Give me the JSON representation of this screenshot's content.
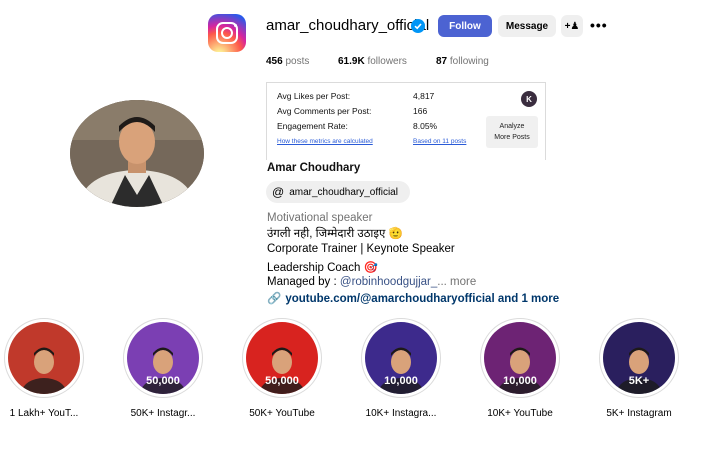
{
  "profile": {
    "username": "amar_choudhary_official",
    "follow_label": "Follow",
    "message_label": "Message",
    "suggest_icon": "add-person-icon",
    "more_icon": "more-dots-icon",
    "brand_color": "#4c63d2"
  },
  "stats": {
    "posts_count": "456",
    "posts_label": "posts",
    "followers_count": "61.9K",
    "followers_label": "followers",
    "following_count": "87",
    "following_label": "following"
  },
  "analytics": {
    "likes_label": "Avg Likes per Post:",
    "likes_value": "4,817",
    "comments_label": "Avg Comments per Post:",
    "comments_value": "166",
    "engagement_label": "Engagement Rate:",
    "engagement_value": "8.05%",
    "metrics_link": "How these metrics are calculated",
    "based_on_link": "Based on 11 posts",
    "analyze_line1": "Analyze",
    "analyze_line2": "More Posts",
    "badge_letter": "K"
  },
  "bio": {
    "full_name": "Amar Choudhary",
    "threads_handle": "amar_choudhary_official",
    "category": "Motivational speaker",
    "line1": "उंगली नही, जिम्मेदारी उठाइए 🫡",
    "line2": "Corporate Trainer | Keynote Speaker",
    "line3": "Leadership Coach 🎯",
    "managed_prefix": "Managed by : ",
    "managed_mention": "@robinhoodgujjar_",
    "ellipsis": "...",
    "more": " more",
    "link_text": "youtube.com/@amarchoudharyofficial and 1 more"
  },
  "highlights": [
    {
      "label": "1 Lakh+ YouT...",
      "badge": "",
      "color": "#c0392b"
    },
    {
      "label": "50K+ Instagr...",
      "badge": "50,000",
      "color": "#7b3fb3"
    },
    {
      "label": "50K+ YouTube",
      "badge": "50,000",
      "color": "#d8231f"
    },
    {
      "label": "10K+ Instagra...",
      "badge": "10,000",
      "color": "#3d2a8c"
    },
    {
      "label": "10K+ YouTube",
      "badge": "10,000",
      "color": "#6d2374"
    },
    {
      "label": "5K+ Instagram",
      "badge": "5K+",
      "color": "#2a1f5e"
    }
  ]
}
